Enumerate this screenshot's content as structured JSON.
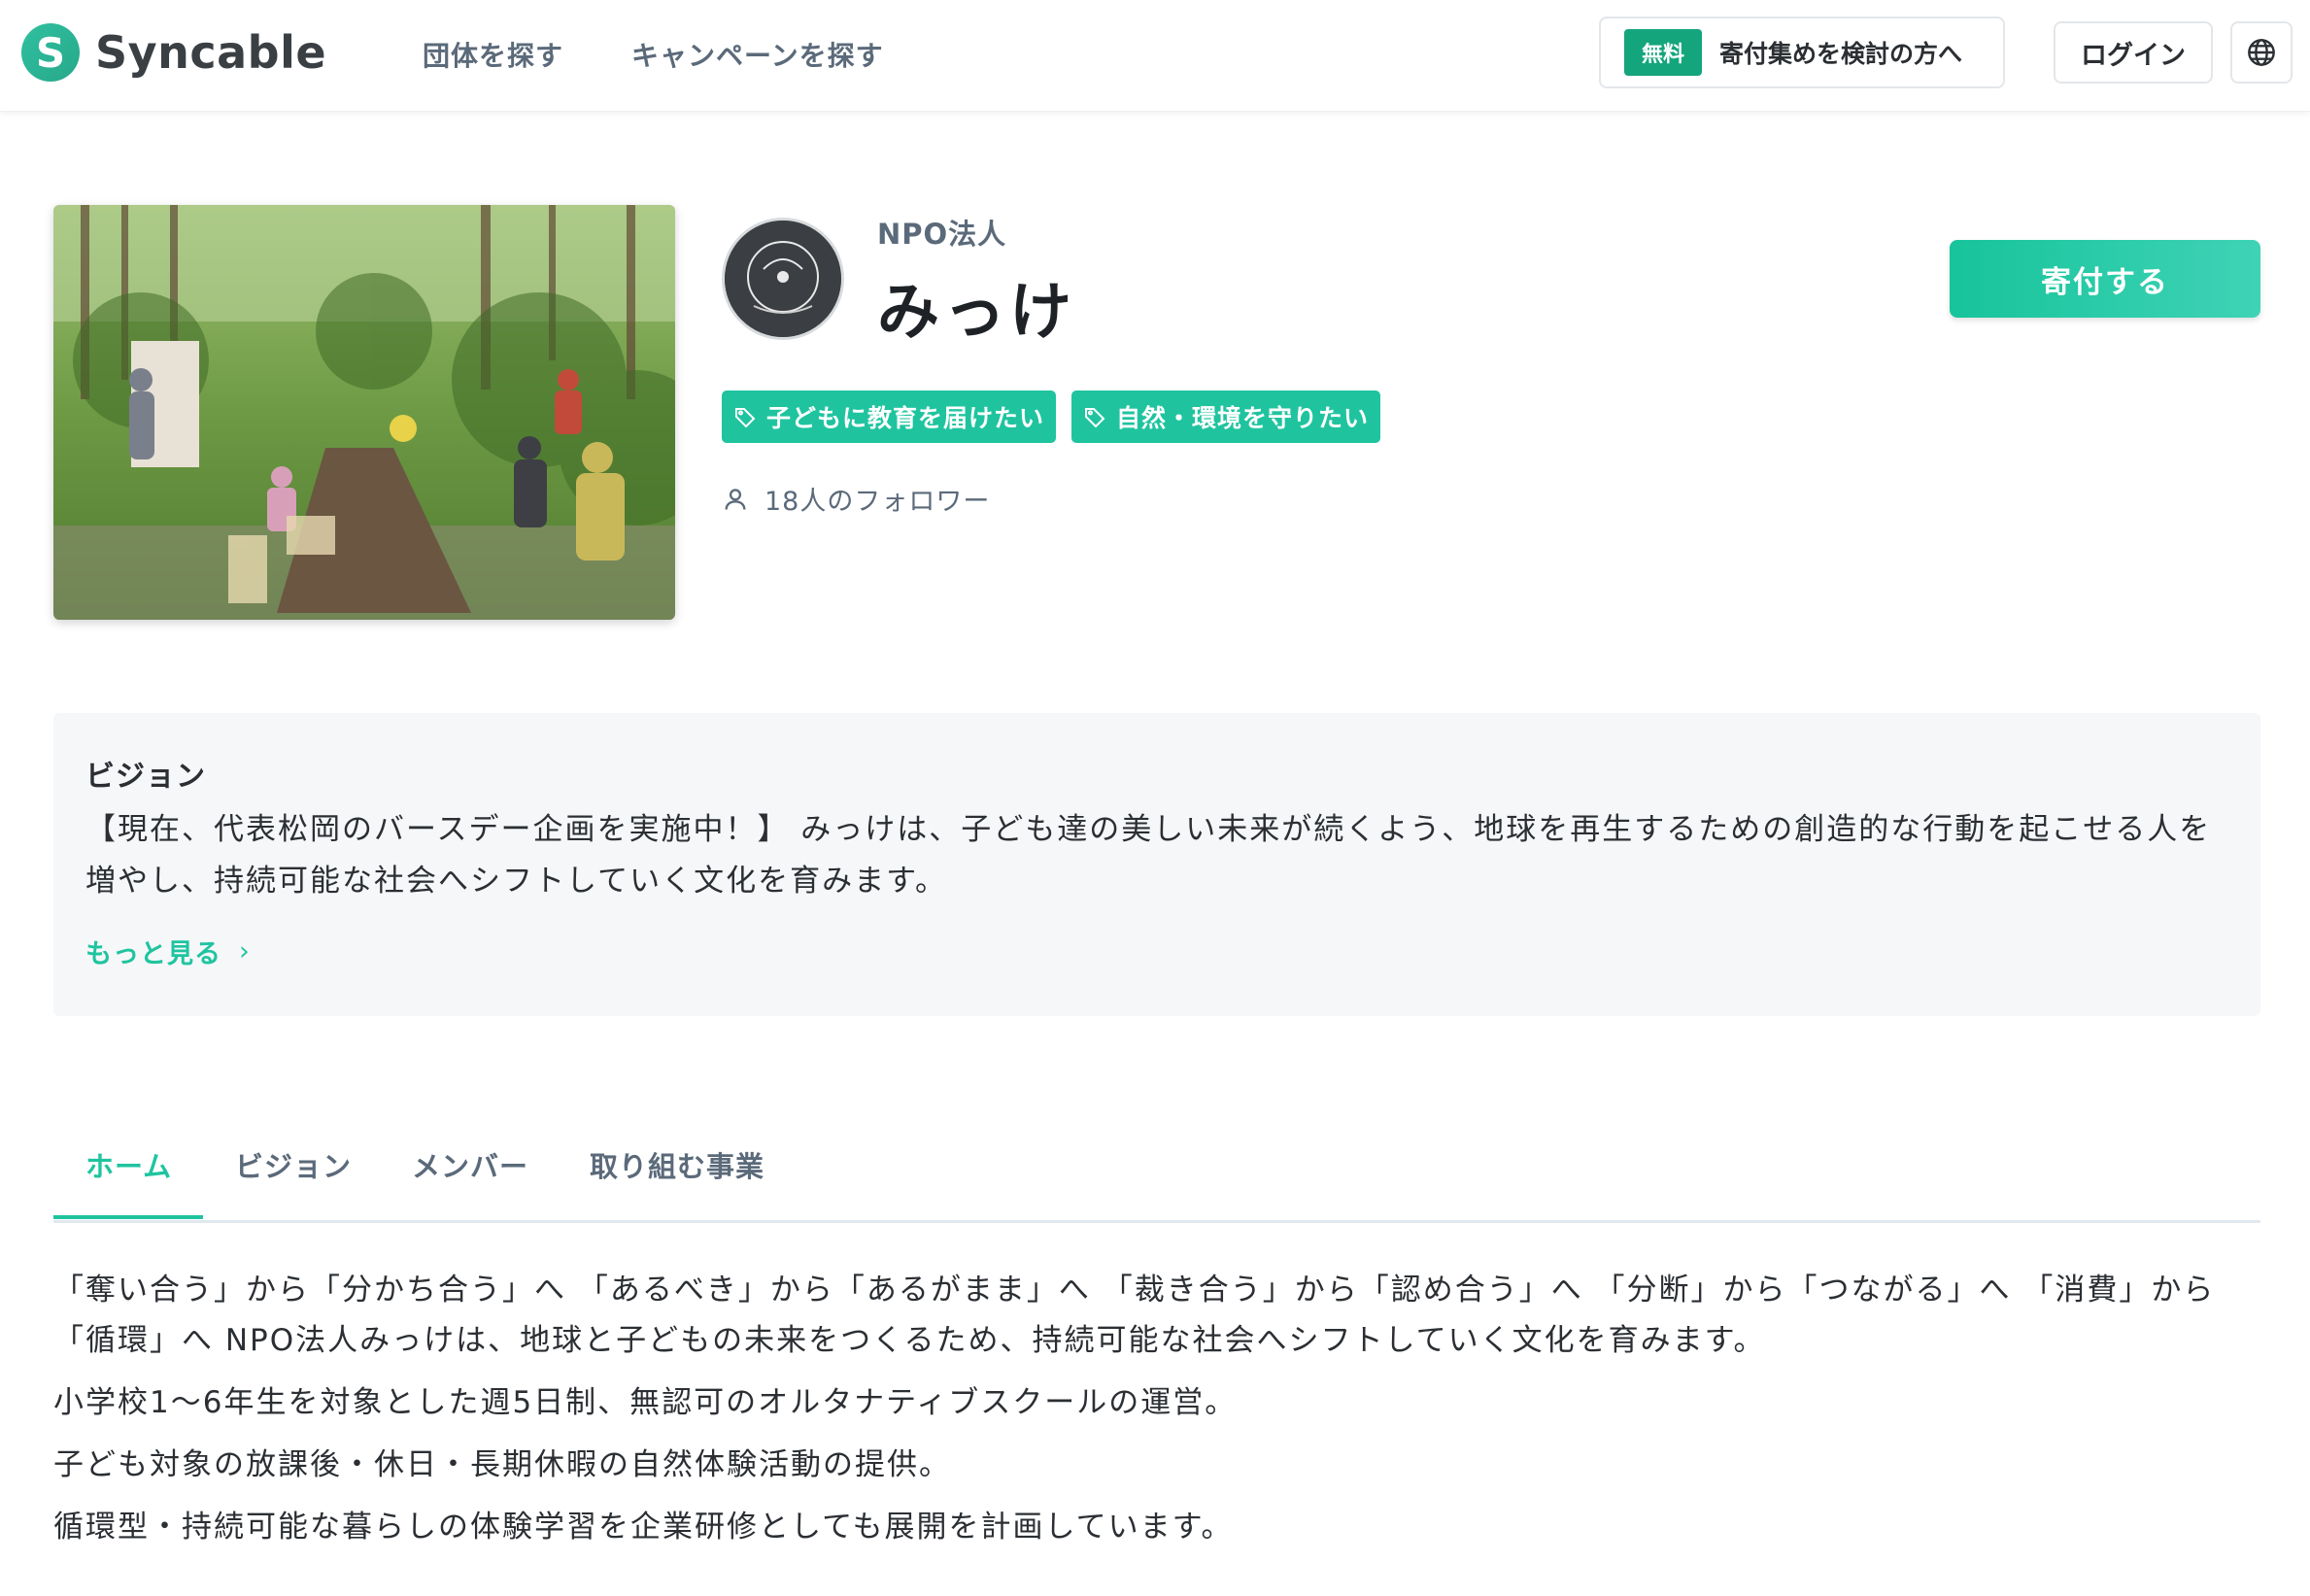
{
  "header": {
    "logo_text": "Syncable",
    "nav": [
      "団体を探す",
      "キャンペーンを探す"
    ],
    "free_badge": "無料",
    "consider_label": "寄付集めを検討の方へ",
    "login_label": "ログイン"
  },
  "profile": {
    "org_type": "NPO法人",
    "org_name": "みっけ",
    "donate_label": "寄付する",
    "tags": [
      "子どもに教育を届けたい",
      "自然・環境を守りたい"
    ],
    "followers": "18人のフォロワー"
  },
  "vision": {
    "title": "ビジョン",
    "text": "【現在、代表松岡のバースデー企画を実施中！】 みっけは、子ども達の美しい未来が続くよう、地球を再生するための創造的な行動を起こせる人を増やし、持続可能な社会へシフトしていく文化を育みます。",
    "more_label": "もっと見る"
  },
  "tabs": [
    "ホーム",
    "ビジョン",
    "メンバー",
    "取り組む事業"
  ],
  "content": {
    "paragraphs": [
      "「奪い合う」から「分かち合う」へ 「あるべき」から「あるがまま」へ 「裁き合う」から「認め合う」へ 「分断」から「つながる」へ 「消費」から「循環」へ NPO法人みっけは、地球と子どもの未来をつくるため、持続可能な社会へシフトしていく文化を育みます。",
      "小学校1〜6年生を対象とした週5日制、無認可のオルタナティブスクールの運営。",
      "子ども対象の放課後・休日・長期休暇の自然体験活動の提供。",
      "循環型・持続可能な暮らしの体験学習を企業研修としても展開を計画しています。"
    ]
  },
  "colors": {
    "brand": "#1fc49f",
    "free_badge": "#14a57c",
    "text": "#2b2f33",
    "muted": "#5b6a7a"
  },
  "icons": [
    "s-logo-icon",
    "globe-icon",
    "tag-icon",
    "person-icon",
    "chevron-right-icon"
  ]
}
